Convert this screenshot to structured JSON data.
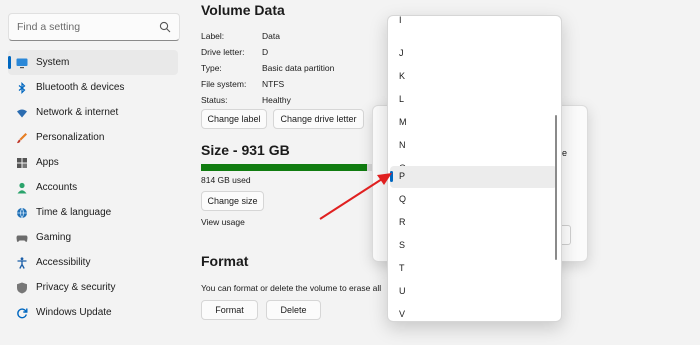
{
  "search": {
    "placeholder": "Find a setting"
  },
  "sidebar": {
    "items": [
      {
        "label": "System",
        "icon": "monitor-icon",
        "active": true
      },
      {
        "label": "Bluetooth & devices",
        "icon": "bluetooth-icon"
      },
      {
        "label": "Network & internet",
        "icon": "wifi-icon"
      },
      {
        "label": "Personalization",
        "icon": "brush-icon"
      },
      {
        "label": "Apps",
        "icon": "apps-icon"
      },
      {
        "label": "Accounts",
        "icon": "person-icon"
      },
      {
        "label": "Time & language",
        "icon": "globe-icon"
      },
      {
        "label": "Gaming",
        "icon": "gamepad-icon"
      },
      {
        "label": "Accessibility",
        "icon": "accessibility-icon"
      },
      {
        "label": "Privacy & security",
        "icon": "shield-icon"
      },
      {
        "label": "Windows Update",
        "icon": "update-icon"
      }
    ]
  },
  "volume": {
    "title": "Volume Data",
    "props": [
      {
        "label": "Label:",
        "value": "Data"
      },
      {
        "label": "Drive letter:",
        "value": "D"
      },
      {
        "label": "Type:",
        "value": "Basic data partition"
      },
      {
        "label": "File system:",
        "value": "NTFS"
      },
      {
        "label": "Status:",
        "value": "Healthy"
      }
    ],
    "change_label_btn": "Change label",
    "change_letter_btn": "Change drive letter"
  },
  "size": {
    "title": "Size - 931 GB",
    "used_text": "814 GB used",
    "used_fraction": 0.874,
    "change_size_btn": "Change size",
    "view_usage": "View usage"
  },
  "format": {
    "title": "Format",
    "description": "You can format or delete the volume to erase all",
    "format_btn": "Format",
    "delete_btn": "Delete"
  },
  "dialog": {
    "partial_text": "ne"
  },
  "dropdown": {
    "options": [
      "I",
      "J",
      "K",
      "L",
      "M",
      "N",
      "O",
      "P",
      "Q",
      "R",
      "S",
      "T",
      "U",
      "V"
    ],
    "selected": "P"
  },
  "colors": {
    "accent": "#0067c0",
    "progress": "#107c10",
    "arrow": "#e02020"
  }
}
